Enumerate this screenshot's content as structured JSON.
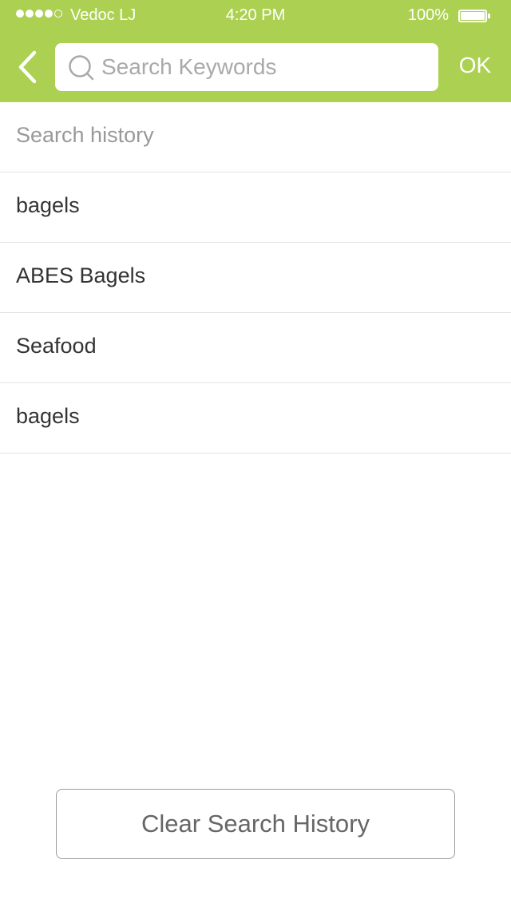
{
  "status_bar": {
    "carrier": "Vedoc LJ",
    "time": "4:20 PM",
    "battery_percent": "100%",
    "battery_level": 1.0,
    "signal_bars_filled": 4,
    "signal_bars_total": 5
  },
  "header": {
    "back_icon": "chevron-left-icon",
    "search": {
      "placeholder": "Search Keywords",
      "value": "",
      "icon": "search-icon"
    },
    "ok_label": "OK"
  },
  "history": {
    "title": "Search history",
    "items": [
      {
        "label": "bagels"
      },
      {
        "label": "ABES Bagels"
      },
      {
        "label": "Seafood"
      },
      {
        "label": "bagels"
      }
    ]
  },
  "clear_button_label": "Clear Search History",
  "colors": {
    "accent": "#acd152",
    "divider": "#e3e3e3",
    "text_primary": "#333333",
    "text_secondary": "#999999"
  }
}
